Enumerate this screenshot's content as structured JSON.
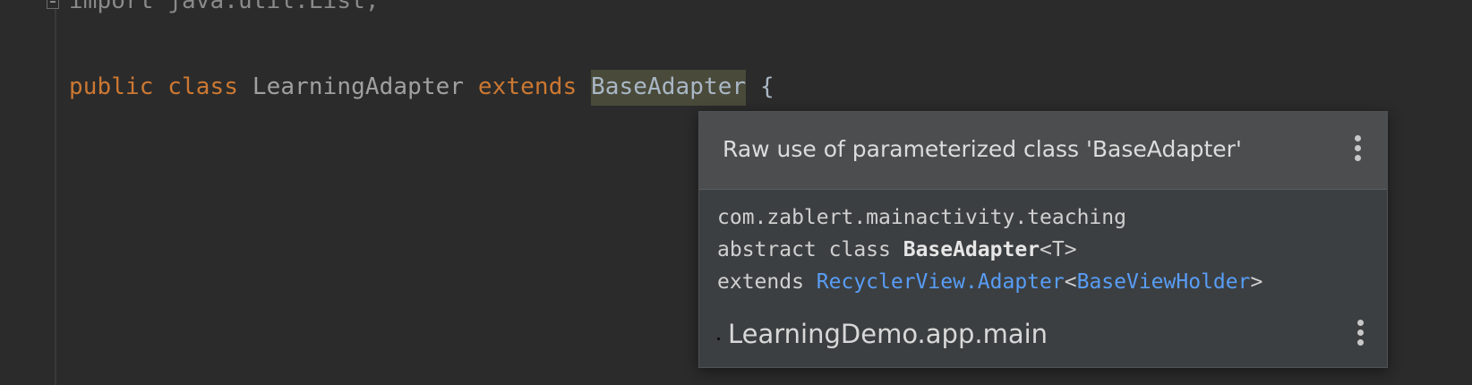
{
  "editor": {
    "import_line": "import java.util.List;",
    "class_line": {
      "kw_public": "public",
      "kw_class": "class",
      "class_name": "LearningAdapter",
      "kw_extends": "extends",
      "base_class": "BaseAdapter",
      "brace": "{"
    }
  },
  "popup": {
    "title": "Raw use of parameterized class 'BaseAdapter'",
    "doc": {
      "package": "com.zablert.mainactivity.teaching",
      "decl_prefix": "abstract class ",
      "decl_name": "BaseAdapter",
      "decl_generic": "<T>",
      "extends_kw": "extends ",
      "extends_link": "RecyclerView.Adapter",
      "lt": "<",
      "type_arg_link": "BaseViewHolder",
      "gt": ">"
    },
    "module": "LearningDemo.app.main"
  },
  "icons": {
    "more_actions": "more-vertical-icon",
    "fold": "fold-minus-icon",
    "module": "module-icon"
  },
  "colors": {
    "background": "#2b2b2b",
    "keyword": "#cc7832",
    "link": "#589df6",
    "popup_bg": "#3c3f41",
    "popup_header_bg": "#4b4d4e"
  }
}
